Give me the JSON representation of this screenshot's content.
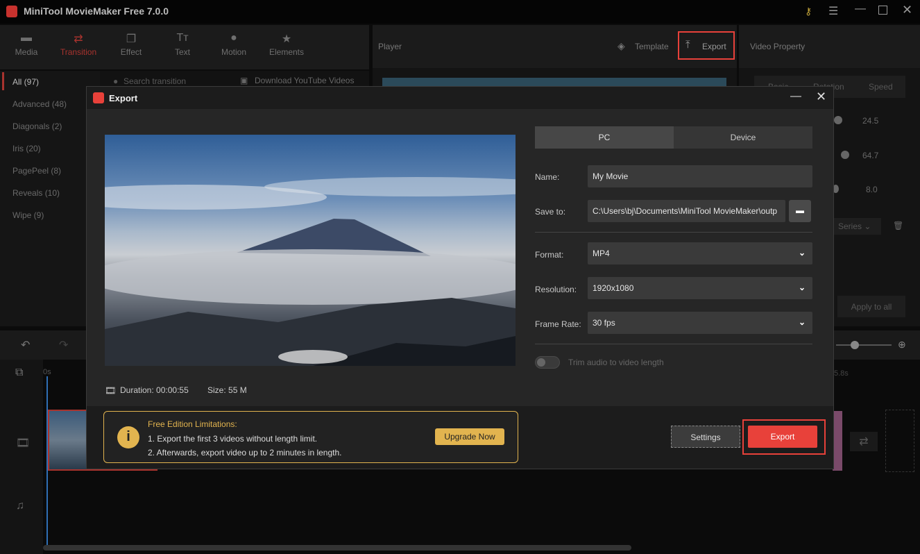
{
  "app": {
    "title": "MiniTool MovieMaker Free 7.0.0"
  },
  "toolbar": {
    "items": [
      {
        "label": "Media",
        "icon": "folder-icon"
      },
      {
        "label": "Transition",
        "icon": "transition-icon"
      },
      {
        "label": "Effect",
        "icon": "effect-icon"
      },
      {
        "label": "Text",
        "icon": "text-icon"
      },
      {
        "label": "Motion",
        "icon": "motion-icon"
      },
      {
        "label": "Elements",
        "icon": "elements-icon"
      }
    ],
    "active": "Transition"
  },
  "categories": [
    "All (97)",
    "Advanced (48)",
    "Diagonals (2)",
    "Iris (20)",
    "PagePeel (8)",
    "Reveals (10)",
    "Wipe (9)"
  ],
  "search": {
    "placeholder": "Search transition"
  },
  "download_link": "Download YouTube Videos",
  "player": {
    "title": "Player",
    "template": "Template",
    "export": "Export"
  },
  "property": {
    "title": "Video Property",
    "tabs": [
      "Basic",
      "Rotation",
      "Speed"
    ],
    "values": [
      "24.5",
      "64.7",
      "8.0"
    ],
    "filter": "Series",
    "apply_all": "Apply to all"
  },
  "timeline": {
    "start": "0s",
    "end": "5.8s"
  },
  "dialog": {
    "title": "Export",
    "tabs": [
      "PC",
      "Device"
    ],
    "name_label": "Name:",
    "name_value": "My Movie",
    "save_label": "Save to:",
    "save_value": "C:\\Users\\bj\\Documents\\MiniTool MovieMaker\\outp",
    "format_label": "Format:",
    "format_value": "MP4",
    "resolution_label": "Resolution:",
    "resolution_value": "1920x1080",
    "framerate_label": "Frame Rate:",
    "framerate_value": "30 fps",
    "trim_label": "Trim audio to video length",
    "trim_on": false,
    "duration_label": "Duration:",
    "duration_value": "00:00:55",
    "size_label": "Size:",
    "size_value": "55 M",
    "limit_title": "Free Edition Limitations:",
    "limit_1": "1. Export the first 3 videos without length limit.",
    "limit_2": "2. Afterwards, export video up to 2 minutes in length.",
    "upgrade": "Upgrade Now",
    "settings": "Settings",
    "export": "Export"
  },
  "colors": {
    "accent": "#e8413a",
    "warning": "#e2b44f"
  }
}
